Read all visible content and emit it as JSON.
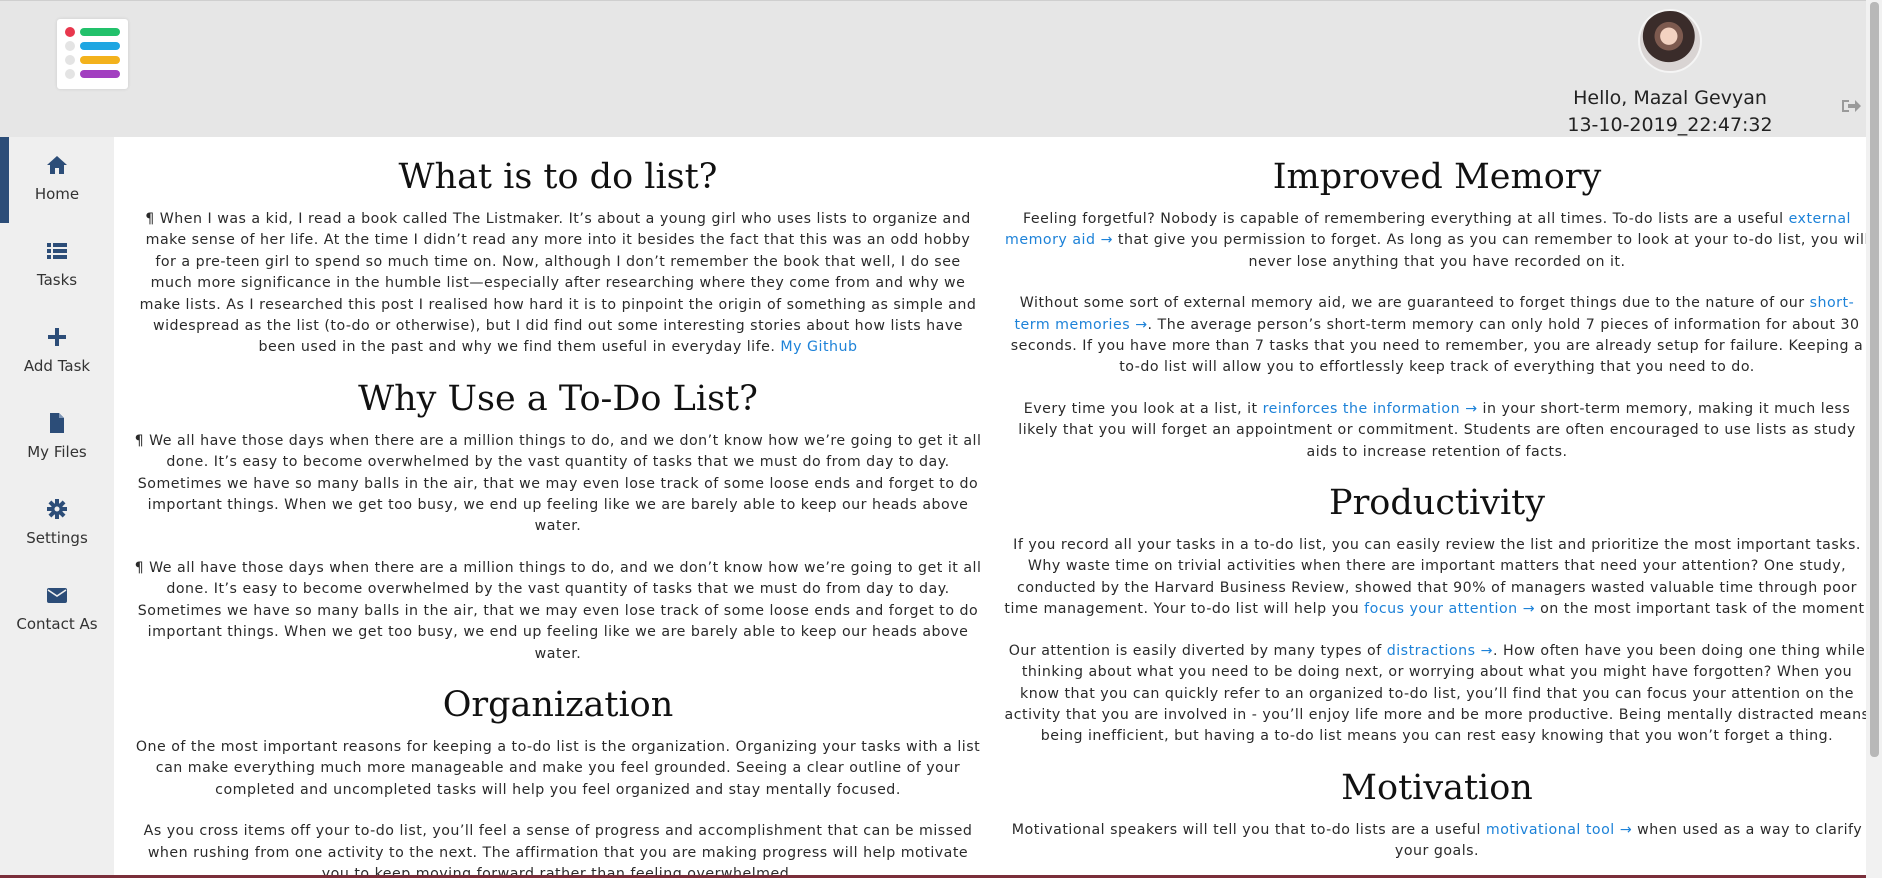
{
  "header": {
    "logo_icon": "todo-list-logo-icon",
    "greeting": "Hello, Mazal Gevyan",
    "datetime": "13-10-2019_22:47:32",
    "logout_icon": "sign-out-icon"
  },
  "colors": {
    "accent": "#2c4d78",
    "link": "#1d82d8",
    "logo_bars": [
      "#22c16b",
      "#1ea6e2",
      "#f3b21c",
      "#a23fc0"
    ],
    "logo_check": "#e8374d"
  },
  "sidebar": {
    "items": [
      {
        "label": "Home",
        "icon": "home-icon",
        "active": true
      },
      {
        "label": "Tasks",
        "icon": "list-icon",
        "active": false
      },
      {
        "label": "Add Task",
        "icon": "plus-icon",
        "active": false
      },
      {
        "label": "My Files",
        "icon": "file-icon",
        "active": false
      },
      {
        "label": "Settings",
        "icon": "gear-icon",
        "active": false
      },
      {
        "label": "Contact As",
        "icon": "envelope-icon",
        "active": false
      }
    ]
  },
  "left": {
    "s1": {
      "title": "What is to do list?",
      "p1": "¶ When I was a kid, I read a book called The Listmaker. It’s about a young girl who uses lists to organize and make sense of her life. At the time I didn’t read any more into it besides the fact that this was an odd hobby for a pre-teen girl to spend so much time on. Now, although I don’t remember the book that well, I do see much more significance in the humble list—especially after researching where they come from and why we make lists. As I researched this post I realised how hard it is to pinpoint the origin of something as simple and widespread as the list (to-do or otherwise), but I did find out some interesting stories about how lists have been used in the past and why we find them useful in everyday life.",
      "link": "My Github"
    },
    "s2": {
      "title": "Why Use a To-Do List?",
      "p1": "¶ We all have those days when there are a million things to do, and we don’t know how we’re going to get it all done. It’s easy to become overwhelmed by the vast quantity of tasks that we must do from day to day. Sometimes we have so many balls in the air, that we may even lose track of some loose ends and forget to do important things. When we get too busy, we end up feeling like we are barely able to keep our heads above water.",
      "p2": "¶ We all have those days when there are a million things to do, and we don’t know how we’re going to get it all done. It’s easy to become overwhelmed by the vast quantity of tasks that we must do from day to day. Sometimes we have so many balls in the air, that we may even lose track of some loose ends and forget to do important things. When we get too busy, we end up feeling like we are barely able to keep our heads above water."
    },
    "s3": {
      "title": "Organization",
      "p1": "One of the most important reasons for keeping a to-do list is the organization. Organizing your tasks with a list can make everything much more manageable and make you feel grounded. Seeing a clear outline of your completed and uncompleted tasks will help you feel organized and stay mentally focused.",
      "p2": "As you cross items off your to-do list, you’ll feel a sense of progress and accomplishment that can be missed when rushing from one activity to the next. The affirmation that you are making progress will help motivate you to keep moving forward rather than feeling overwhelmed."
    }
  },
  "right": {
    "s1": {
      "title": "Improved Memory",
      "p1a": "Feeling forgetful? Nobody is capable of remembering everything at all times. To-do lists are a useful ",
      "p1link": "external memory aid →",
      "p1b": " that give you permission to forget. As long as you can remember to look at your to-do list, you will never lose anything that you have recorded on it.",
      "p2a": "Without some sort of external memory aid, we are guaranteed to forget things due to the nature of our ",
      "p2link": "short-term memories →",
      "p2b": ". The average person’s short-term memory can only hold 7 pieces of information for about 30 seconds. If you have more than 7 tasks that you need to remember, you are already setup for failure. Keeping a to-do list will allow you to effortlessly keep track of everything that you need to do.",
      "p3a": "Every time you look at a list, it ",
      "p3link": "reinforces the information →",
      "p3b": " in your short-term memory, making it much less likely that you will forget an appointment or commitment. Students are often encouraged to use lists as study aids to increase retention of facts."
    },
    "s2": {
      "title": "Productivity",
      "p1a": "If you record all your tasks in a to-do list, you can easily review the list and prioritize the most important tasks. Why waste time on trivial activities when there are important matters that need your attention? One study, conducted by the Harvard Business Review, showed that 90% of managers wasted valuable time through poor time management. Your to-do list will help you ",
      "p1link": "focus your attention →",
      "p1b": " on the most important task of the moment.",
      "p2a": "Our attention is easily diverted by many types of ",
      "p2link": "distractions →",
      "p2b": ". How often have you been doing one thing while thinking about what you need to be doing next, or worrying about what you might have forgotten? When you know that you can quickly refer to an organized to-do list, you’ll find that you can focus your attention on the activity that you are involved in - you’ll enjoy life more and be more productive. Being mentally distracted means being inefficient, but having a to-do list means you can rest easy knowing that you won’t forget a thing."
    },
    "s3": {
      "title": "Motivation",
      "p1a": "Motivational speakers will tell you that to-do lists are a useful ",
      "p1link": "motivational tool →",
      "p1b": " when used as a way to clarify your goals."
    }
  }
}
